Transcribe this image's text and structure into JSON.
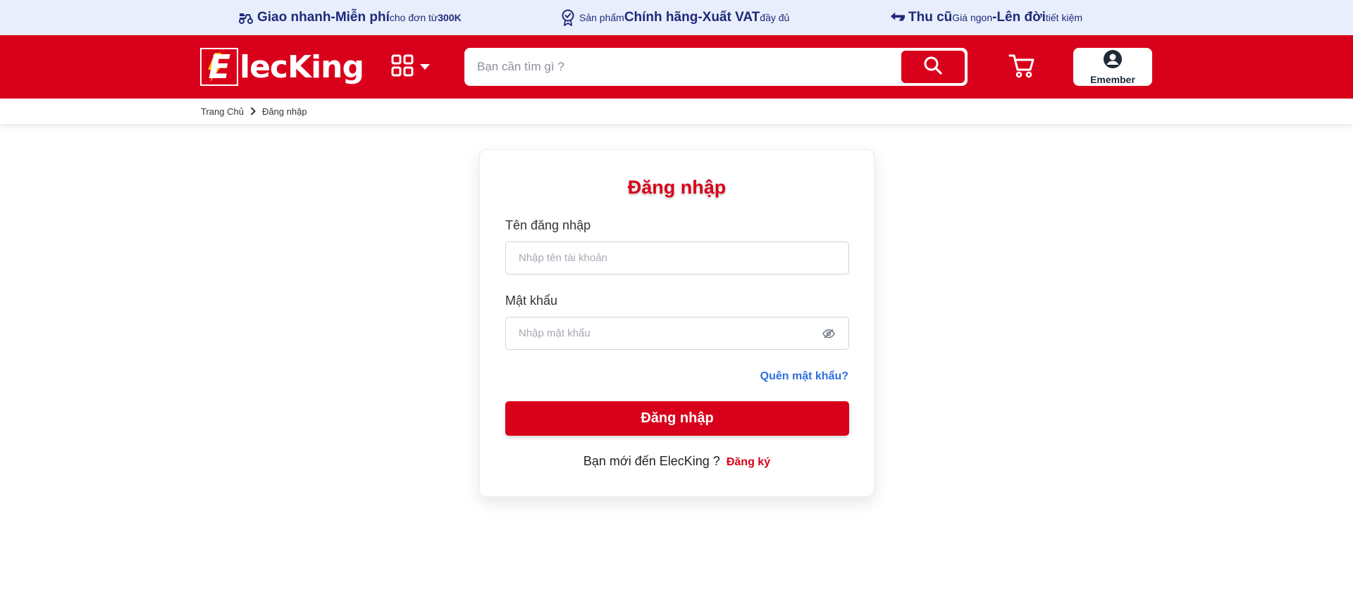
{
  "promo": {
    "items": [
      {
        "icon": "delivery-scooter-icon",
        "parts": [
          "Giao nhanh",
          " - ",
          "Miễn phí",
          " cho đơn từ ",
          "300K"
        ]
      },
      {
        "icon": "badge-check-icon",
        "parts": [
          "Sản phẩm ",
          "Chính hãng",
          " - ",
          "Xuất VAT",
          " đầy đủ"
        ]
      },
      {
        "icon": "exchange-arrow-icon",
        "parts": [
          "Thu cũ",
          " Giá ngon ",
          "-",
          " Lên đời",
          " tiết kiệm"
        ]
      }
    ]
  },
  "header": {
    "logo_initial": "E",
    "logo_text": "lecKing",
    "search_placeholder": "Bạn cần tìm gì ?",
    "member_label": "Emember"
  },
  "breadcrumb": {
    "home": "Trang Chủ",
    "current": "Đăng nhập"
  },
  "login": {
    "title": "Đăng nhập",
    "username_label": "Tên đăng nhập",
    "username_placeholder": "Nhập tên tài khoản",
    "password_label": "Mật khẩu",
    "password_placeholder": "Nhập mật khẩu",
    "forgot_label": "Quên mật khẩu?",
    "submit_label": "Đăng nhập",
    "signup_prompt": "Bạn mới đến ElecKing ?",
    "signup_link": "Đăng ký"
  },
  "colors": {
    "brand_red": "#d9001b",
    "promo_bg": "#e8eefc",
    "promo_text": "#1e2a78",
    "link_blue": "#2f6fdf"
  }
}
